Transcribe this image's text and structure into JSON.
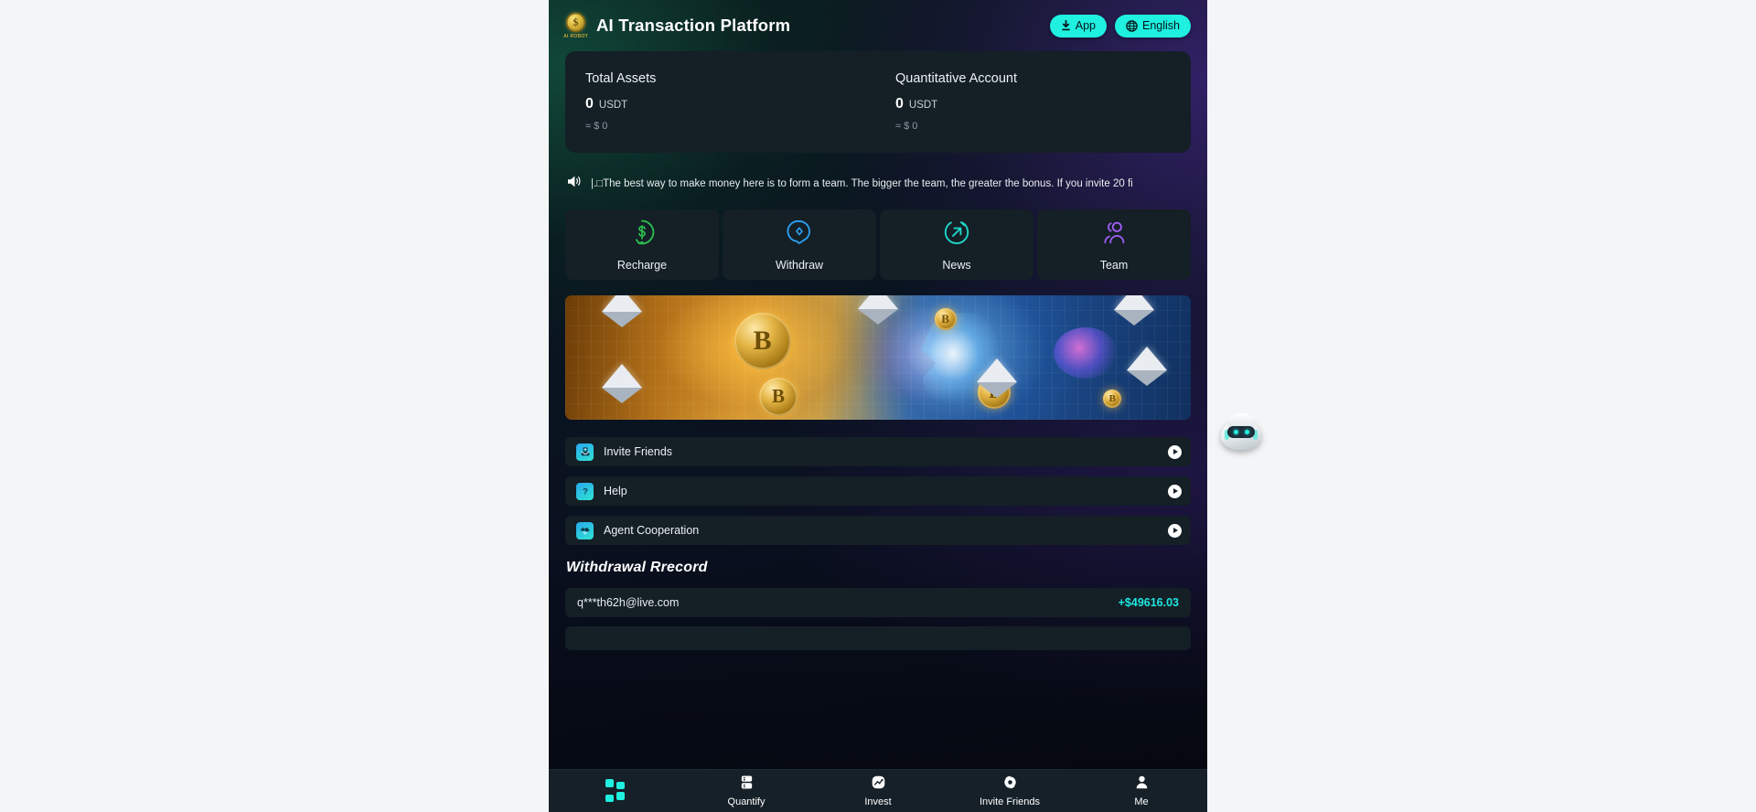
{
  "header": {
    "logo_text": "AI ROBOT",
    "title": "AI Transaction Platform",
    "app_button": "App",
    "language_button": "English"
  },
  "balance": {
    "cards": [
      {
        "title": "Total Assets",
        "amount": "0",
        "currency": "USDT",
        "approx": "≈ $ 0"
      },
      {
        "title": "Quantitative Account",
        "amount": "0",
        "currency": "USDT",
        "approx": "≈ $ 0"
      }
    ]
  },
  "announcement": {
    "text": "|.□The best way to make money here is to form a team. The bigger the team, the greater the bonus. If you invite 20 fi"
  },
  "actions": [
    {
      "label": "Recharge",
      "icon": "dollar-circle-icon",
      "color": "#2bbd4e"
    },
    {
      "label": "Withdraw",
      "icon": "location-pin-icon",
      "color": "#2b9ceb"
    },
    {
      "label": "News",
      "icon": "arrow-circle-icon",
      "color": "#1fd6c8"
    },
    {
      "label": "Team",
      "icon": "people-icon",
      "color": "#9b5cf0"
    }
  ],
  "banner": {
    "alt": "crypto-ai-banner"
  },
  "menu": [
    {
      "label": "Invite Friends",
      "icon": "invite-inbox-icon"
    },
    {
      "label": "Help",
      "icon": "question-mark-icon"
    },
    {
      "label": "Agent Cooperation",
      "icon": "handshake-icon"
    }
  ],
  "withdrawal": {
    "section_title": "Withdrawal Rrecord",
    "records": [
      {
        "account": "q***th62h@live.com",
        "amount": "+$49616.03"
      },
      {
        "account": "",
        "amount": ""
      }
    ]
  },
  "bottom_nav": [
    {
      "label": "",
      "icon": "home-grid-icon",
      "active": true
    },
    {
      "label": "Quantify",
      "icon": "server-icon",
      "active": false
    },
    {
      "label": "Invest",
      "icon": "trend-chart-icon",
      "active": false
    },
    {
      "label": "Invite Friends",
      "icon": "share-network-icon",
      "active": false
    },
    {
      "label": "Me",
      "icon": "user-icon",
      "active": false
    }
  ],
  "assistant": {
    "name": "robot-assistant"
  },
  "colors": {
    "accent": "#1ff0e0",
    "card": "#141f26",
    "nav": "#152028"
  }
}
